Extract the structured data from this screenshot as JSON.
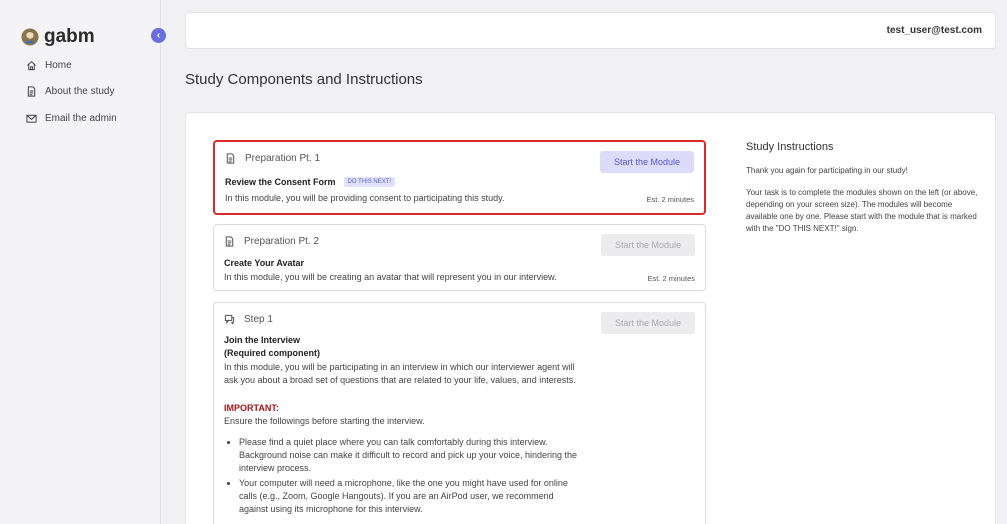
{
  "app": {
    "brand": "gabm",
    "user_email": "test_user@test.com"
  },
  "sidebar": {
    "collapse_icon": "chevron-left-icon",
    "items": [
      {
        "label": "Home",
        "icon": "home-icon"
      },
      {
        "label": "About the study",
        "icon": "document-icon"
      },
      {
        "label": "Email the admin",
        "icon": "mail-icon"
      }
    ]
  },
  "page": {
    "title": "Study Components and Instructions"
  },
  "modules": [
    {
      "header": "Preparation Pt. 1",
      "icon": "document-icon",
      "button": "Start the Module",
      "title": "Review the Consent Form",
      "badge": "DO THIS NEXT!",
      "description": "In this module, you will be providing consent to participating this study.",
      "estimate": "Est. 2 minutes"
    },
    {
      "header": "Preparation Pt. 2",
      "icon": "document-icon",
      "button": "Start the Module",
      "title": "Create Your Avatar",
      "description": "In this module, you will be creating an avatar that will represent you in our interview.",
      "estimate": "Est. 2 minutes"
    },
    {
      "header": "Step 1",
      "icon": "chat-icon",
      "button": "Start the Module",
      "title": "Join the Interview",
      "subtitle": "(Required component)",
      "description": "In this module, you will be participating in an interview in which our interviewer agent will ask you about a broad set of questions that are related to your life, values, and interests.",
      "important_label": "IMPORTANT:",
      "important_text": "Ensure the followings before starting the interview.",
      "bullets": [
        "Please find a quiet place where you can talk comfortably during this interview. Background noise can make it difficult to record and pick up your voice, hindering the interview process.",
        "Your computer will need a microphone, like the one you might have used for online calls (e.g., Zoom, Google Hangouts). If you are an AirPod user, we recommend against using its microphone for this interview."
      ]
    }
  ],
  "instructions": {
    "title": "Study Instructions",
    "p1": "Thank you again for participating in our study!",
    "p2": "Your task is to complete the modules shown on the left (or above, depending on your screen size). The modules will become available one by one. Please start with the module that is marked with the \"DO THIS NEXT!\" sign."
  },
  "colors": {
    "accent": "#6a6fe0",
    "highlight_border": "#d82a2a",
    "important": "#a01818"
  }
}
